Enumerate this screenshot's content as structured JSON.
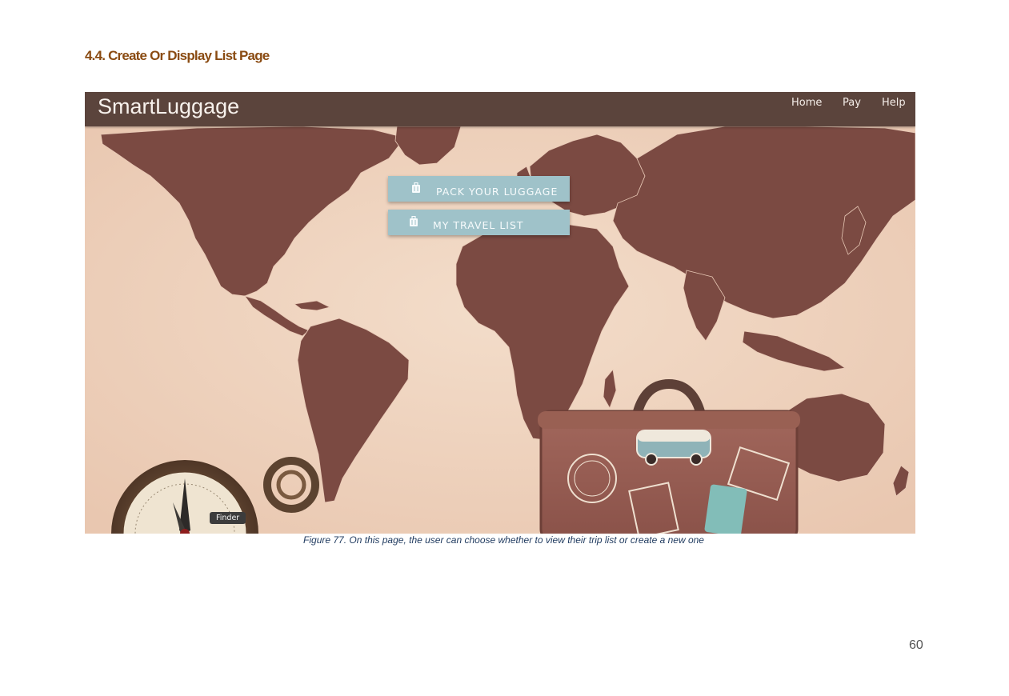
{
  "document": {
    "section_heading": "4.4. Create Or Display List Page",
    "figure_caption": "Figure 77. On this page, the user can choose whether to view their trip list or create a new one",
    "page_number": "60"
  },
  "app": {
    "brand": "SmartLuggage",
    "nav": [
      {
        "label": "Home"
      },
      {
        "label": "Pay"
      },
      {
        "label": "Help"
      }
    ],
    "actions": {
      "pack_label": "PACK YOUR LUGGAGE",
      "list_label": "MY TRAVEL LIST",
      "icon": "suitcase-icon"
    },
    "finder_tooltip": "Finder",
    "colors": {
      "navbar": "#5b443c",
      "map_land": "#7b4a42",
      "map_background": "#f0d6c1",
      "button": "#9fc2c9",
      "heading": "#8a4b12"
    }
  }
}
